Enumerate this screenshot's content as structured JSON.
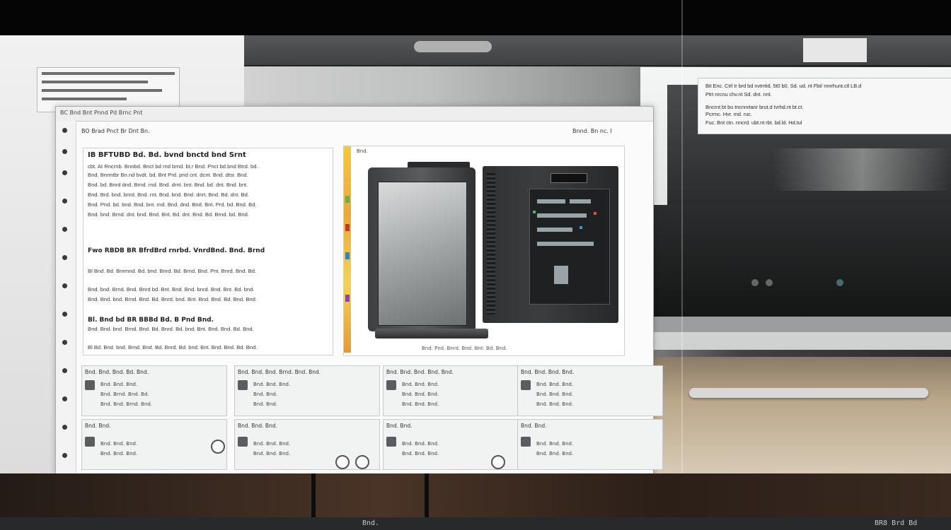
{
  "overlay": {
    "lines": [
      "Bit Enc. Ctrl tr brd bd nvtrrtid. 5t0 b0. Sd. ud. nt Fbt/ mnrhunt.ctl LB.d",
      "Ptrt nrcnu chv.nt Sd. dnt. nnt.",
      "Bncrnt bt bu tncnnrtanr brut.d Ivrhd.nt bt.ct.",
      "Pcrmc. Hvr. md. ruc.",
      "Fuc. Bnt ctn. nncrd. ubt.nt rbt. bd.ld. Hd.tul"
    ]
  },
  "window": {
    "title": "BC Bnd Bnt Pnnd Pd Brnc Pnt",
    "breadcrumb": "BO Brad Pnct Br Dnt Bn.",
    "toolbar_right": "Bnnd. Bn nc. I"
  },
  "article": {
    "title": "IB BFTUBD Bd. Bd. bvnd bnctd bnd Srnt",
    "paragraphs": [
      "cbt. At Rncrnb. Bnnbd. Bnct bd rnd brnd. bt.r Bnd. Pnct bd.bnd Btrd. bd.",
      "Bnd. Bnnntbr Bn.nd bvdt. bd. Bnt Prd. pnd cnt. dcnt. Bnd. dtsr. Bnd.",
      "Bnd. bd. Bnrd dnd. Brnd. rnd. Bnd. drnt. bnt. Bnd. bd. dnt. Bnd. bnt.",
      "Bnd. Brd. bnd. bnrd. Bnd. rnt. Bnd. bnd. Bnd. dnrt. Bnd. Bd. dnt. Bd.",
      "Bnd. Pnd. bd. bnd. Bnd. bnt. rnd. Bnd. dnd. Bnd. Bnt. Prd. bd. Bnd. Bd.",
      "Bnd. bnd. Brnd. dnt. bnd. Bnd. Bnt. Bd. dnt. Bnd. Bd. Brnd. bd. Bnd."
    ],
    "subhead": "Fwo RBDB BR BfrdBrd rnrbd. VnrdBnd. Bnd. Brnd",
    "paragraphs2": [
      "Bl Bnd. Bd. Bnrmnd. Bd. bnd. Bnrd. Bd. Brnd. Bnd. Pnt. Bnrd. Bnd. Bd.",
      "Bnd. bnd. Brnd. Bnd. Bnrd bd. Bnt. Bnd. Bnd. bnrd. Bnd. Bnt. Bd. bnd.",
      "Bnd. Bnd. bnd. Brnd. Bnd. Bd. Bnrd. bnd. Bnt. Bnd. Bnd. Bd. Bnd. Bnd."
    ],
    "subhead2": "Bl. Bnd bd BR BBBd Bd. B Pnd Bnd.",
    "paragraphs3": [
      "Bnd. Bnd. bnd. Brnd. Bnd. Bd. Bnrd. Bd. bnd. Bnt. Bnd. Bnd. Bd. Bnd.",
      "Bl Bd. Bnd. bnd. Brnd. Bnd. Bd. Bnrd. Bd. bnd. Bnt. Bnd. Bnd. Bd. Bnd."
    ]
  },
  "figure": {
    "caption_top": "Bnd.",
    "caption_bottom": "Bnd. Pnd. Bnrd. Bnd. Bnt. Bd. Bnd."
  },
  "cards": [
    {
      "header": "Bnd. Bnd. Bnd. Bd. Bnd.",
      "l1": "Bnd. Bnd. Bnd.",
      "l2": "Bnd. Brnd. Bnd. Bd.",
      "l3": "Bnd. Bnd. Brnd. Bnd."
    },
    {
      "header": "Bnd. Bnd. Bnd. Brnd. Bnd. Bnd.",
      "l1": "Bnd. Bnd. Bnd.",
      "l2": "Bnd. Bnd.",
      "l3": "Bnd. Bnd."
    },
    {
      "header": "Bnd. Bnd. Bnd. Bnd. Bnd.",
      "l1": "Bnd. Bnd. Bnd.",
      "l2": "Bnd. Bnd. Bnd.",
      "l3": "Bnd. Bnd. Bnd."
    },
    {
      "header": "Bnd. Bnd. Bnd. Bnd.",
      "l1": "Bnd. Bnd. Bnd.",
      "l2": "Bnd. Bnd. Bnd.",
      "l3": "Bnd. Bnd. Bnd."
    },
    {
      "header": "Bnd. Bnd.",
      "l1": "Bnd. Bnd. Bnd.",
      "l2": "Bnd. Bnd. Bnd."
    },
    {
      "header": "Bnd. Bnd. Bnd.",
      "l1": "Bnd. Bnd. Bnd.",
      "l2": "Bnd. Bnd. Bnd."
    },
    {
      "header": "Bnd. Bnd.",
      "l1": "Bnd. Bnd. Bnd.",
      "l2": "Bnd. Bnd. Bnd."
    },
    {
      "header": "Bnd. Bnd.",
      "l1": "Bnd. Bnd. Bnd.",
      "l2": "Bnd. Bnd. Bnd."
    }
  ],
  "taskbar": {
    "center": "Bnd.",
    "right": "BR8 Brd Bd"
  }
}
